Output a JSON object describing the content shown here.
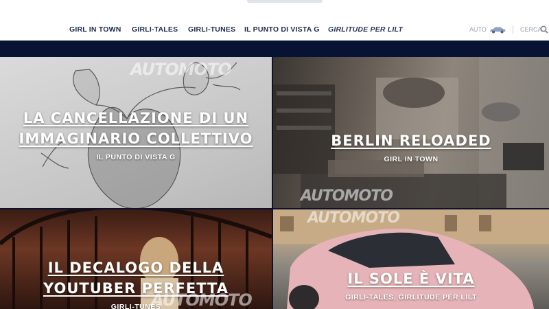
{
  "nav": {
    "items": [
      {
        "label": "GIRL IN TOWN"
      },
      {
        "label": "GIRLI-TALES"
      },
      {
        "label": "GIRLI-TUNES"
      },
      {
        "label": "IL PUNTO DI VISTA G"
      },
      {
        "label": "GIRLITUDE PER LILT"
      }
    ],
    "auto_label": "AUTO",
    "search_label": "CERCA"
  },
  "tiles": [
    {
      "title_lines": [
        "LA CANCELLAZIONE DI UN",
        "IMMAGINARIO COLLETTIVO"
      ],
      "category": "IL PUNTO DI VISTA G"
    },
    {
      "title_lines": [
        "BERLIN RELOADED"
      ],
      "category": "GIRL IN TOWN"
    },
    {
      "title_lines": [
        "IL DECALOGO DELLA",
        "YOUTUBER PERFETTA"
      ],
      "category": "GIRLI-TUNES"
    },
    {
      "title_lines": [
        "IL SOLE È VITA"
      ],
      "category": "GIRLI-TALES, GIRLITUDE PER LILT"
    }
  ],
  "watermark": "AUTOMOTO",
  "colors": {
    "nav_text": "#1e2a4a",
    "dark_bar": "#081233",
    "util_text": "#9aa2ae"
  },
  "icons": {
    "auto": "car-icon",
    "search": "search-icon"
  }
}
